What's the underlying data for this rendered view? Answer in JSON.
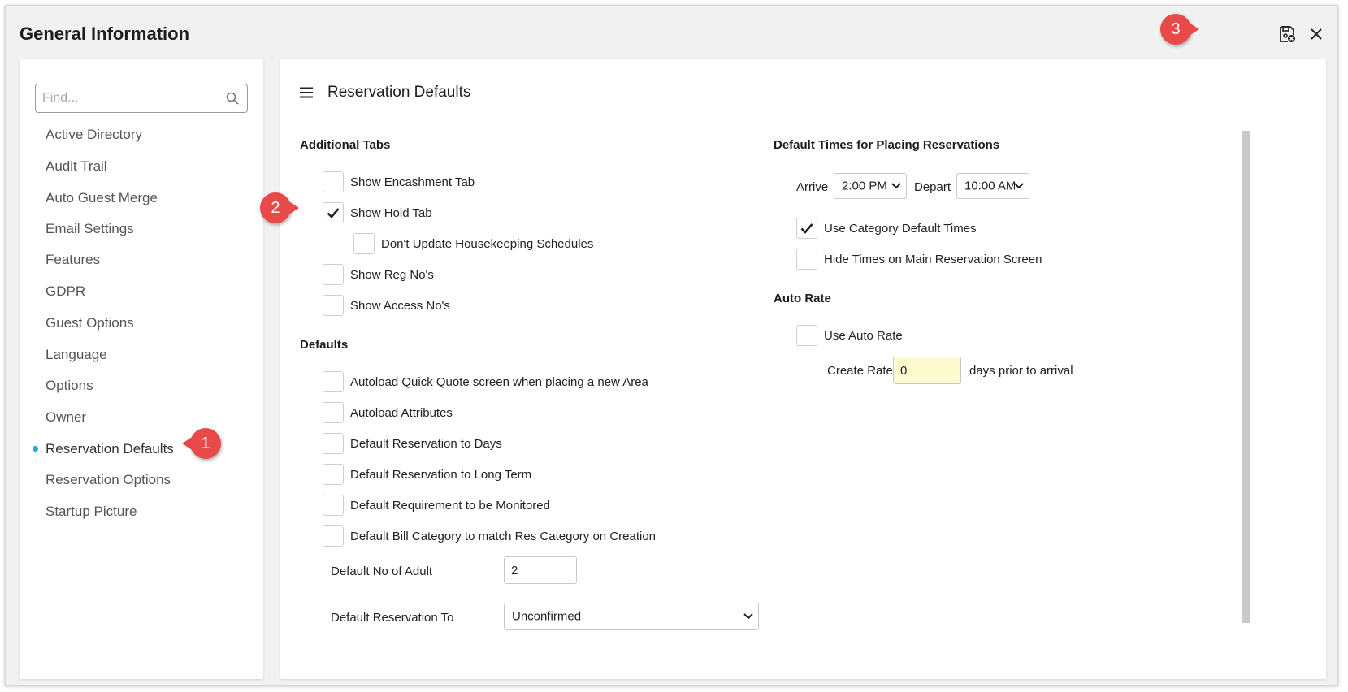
{
  "window": {
    "title": "General Information"
  },
  "colors": {
    "accent_dot": "#29a8e0",
    "badge": "#e84a4a",
    "input_highlight": "#fffbd0"
  },
  "icons": {
    "save": "save-disk-icon",
    "close": "close-icon",
    "search": "search-icon",
    "menu": "hamburger-menu-icon",
    "check": "checkmark-icon",
    "chevron": "chevron-down-icon"
  },
  "sidebar": {
    "search_placeholder": "Find...",
    "items": [
      {
        "label": "Active Directory"
      },
      {
        "label": "Audit Trail"
      },
      {
        "label": "Auto Guest Merge"
      },
      {
        "label": "Email Settings"
      },
      {
        "label": "Features"
      },
      {
        "label": "GDPR"
      },
      {
        "label": "Guest Options"
      },
      {
        "label": "Language"
      },
      {
        "label": "Options"
      },
      {
        "label": "Owner"
      },
      {
        "label": "Reservation Defaults",
        "active": true
      },
      {
        "label": "Reservation Options"
      },
      {
        "label": "Startup Picture"
      }
    ]
  },
  "main": {
    "title": "Reservation Defaults",
    "additional_tabs": {
      "heading": "Additional Tabs",
      "items": [
        {
          "label": "Show Encashment Tab",
          "checked": false
        },
        {
          "label": "Show Hold Tab",
          "checked": true
        },
        {
          "label": "Don't Update Housekeeping Schedules",
          "checked": false
        },
        {
          "label": "Show Reg No's",
          "checked": false
        },
        {
          "label": "Show Access No's",
          "checked": false
        }
      ]
    },
    "defaults": {
      "heading": "Defaults",
      "items": [
        {
          "label": "Autoload Quick Quote screen when placing a new Area",
          "checked": false
        },
        {
          "label": "Autoload Attributes",
          "checked": false
        },
        {
          "label": "Default Reservation to Days",
          "checked": false
        },
        {
          "label": "Default Reservation to Long Term",
          "checked": false
        },
        {
          "label": "Default Requirement to be Monitored",
          "checked": false
        },
        {
          "label": "Default Bill Category to match Res Category on Creation",
          "checked": false
        }
      ],
      "adult_label": "Default No of Adult",
      "adult_value": "2",
      "res_to_label": "Default Reservation To",
      "res_to_value": "Unconfirmed"
    },
    "default_times": {
      "heading": "Default Times for Placing Reservations",
      "arrive_label": "Arrive",
      "arrive_value": "2:00 PM",
      "depart_label": "Depart",
      "depart_value": "10:00 AM",
      "items": [
        {
          "label": "Use Category Default Times",
          "checked": true
        },
        {
          "label": "Hide Times on Main Reservation Screen",
          "checked": false
        }
      ]
    },
    "auto_rate": {
      "heading": "Auto Rate",
      "use_label": "Use Auto Rate",
      "use_checked": false,
      "create_rate_label": "Create Rate",
      "create_rate_value": "0",
      "suffix": "days prior to arrival"
    }
  },
  "callouts": [
    "1",
    "2",
    "3"
  ]
}
